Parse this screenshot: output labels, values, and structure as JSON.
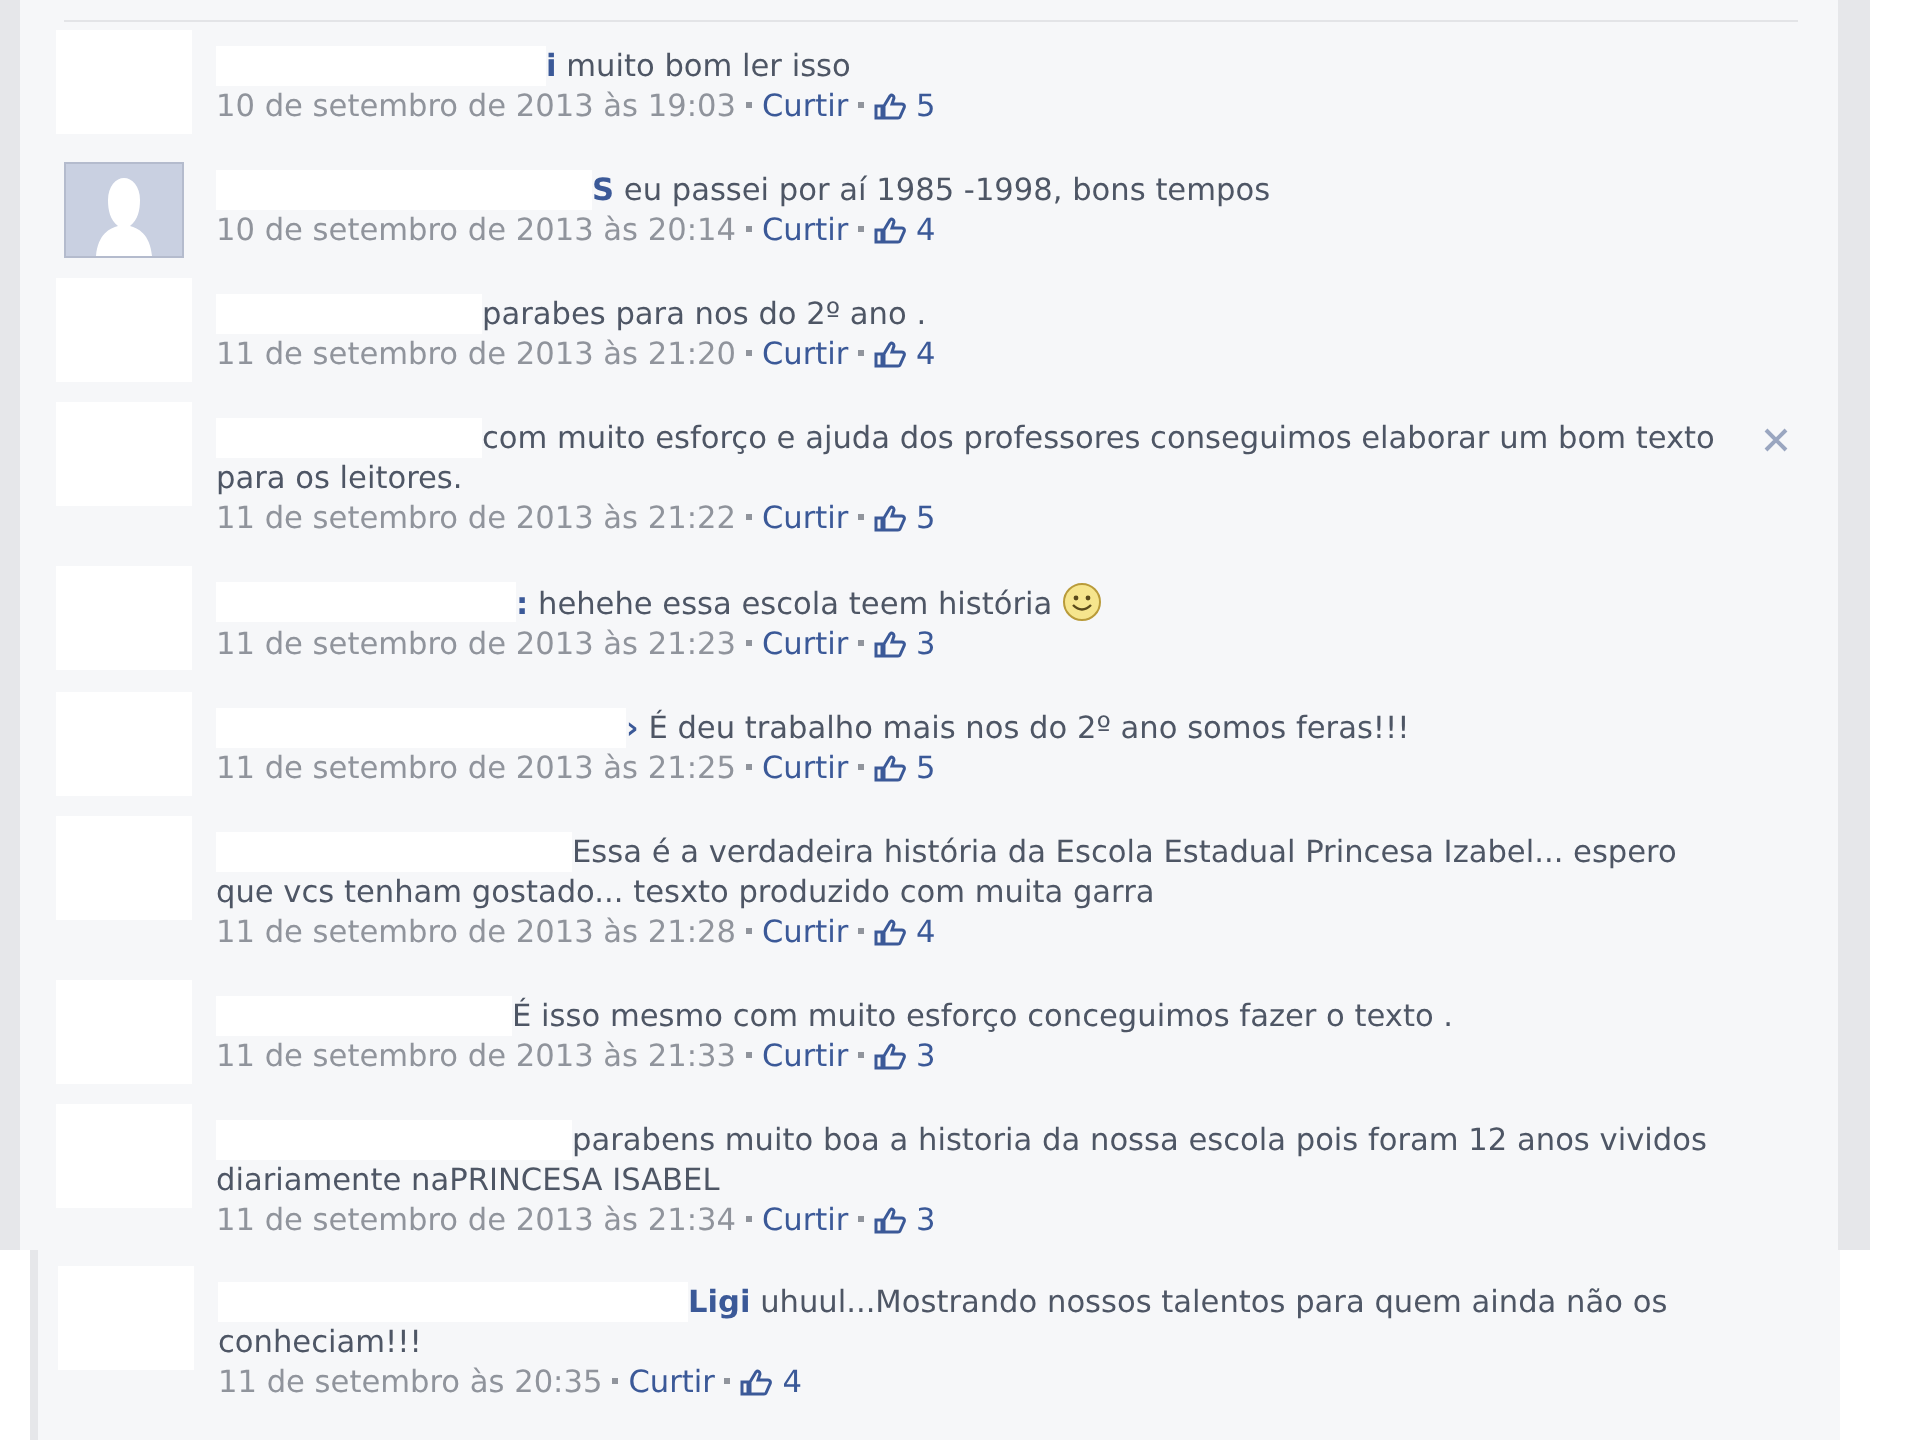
{
  "comments": [
    {
      "avatar": {
        "kind": "hidden"
      },
      "name": "i",
      "text": "muito bom ler isso",
      "time": "10 de setembro de 2013 às 19:03",
      "like_label": "Curtir",
      "likes": "5"
    },
    {
      "avatar": {
        "kind": "silhouette"
      },
      "name": "S",
      "text": "eu passei por aí 1985 -1998, bons tempos",
      "time": "10 de setembro de 2013 às 20:14",
      "like_label": "Curtir",
      "likes": "4"
    },
    {
      "avatar": {
        "kind": "hidden"
      },
      "text": "parabes para nos do 2º ano .",
      "time": "11 de setembro de 2013 às 21:20",
      "like_label": "Curtir",
      "likes": "4"
    },
    {
      "avatar": {
        "kind": "hidden"
      },
      "text": "com muito esforço e ajuda dos professores conseguimos elaborar um bom texto para os leitores.",
      "time": "11 de setembro de 2013 às 21:22",
      "like_label": "Curtir",
      "likes": "5",
      "close_button": true
    },
    {
      "avatar": {
        "kind": "hidden"
      },
      "name": ":",
      "text": "hehehe essa escola teem história",
      "emoticon": {
        "kind": "smile"
      },
      "time": "11 de setembro de 2013 às 21:23",
      "like_label": "Curtir",
      "likes": "3"
    },
    {
      "avatar": {
        "kind": "hidden"
      },
      "name": "›",
      "text": "É deu trabalho mais nos do 2º ano somos feras!!!",
      "time": "11 de setembro de 2013 às 21:25",
      "like_label": "Curtir",
      "likes": "5"
    },
    {
      "avatar": {
        "kind": "hidden"
      },
      "text": "Essa é a verdadeira história da Escola Estadual Princesa Izabel... espero que vcs tenham gostado... tesxto produzido com muita garra",
      "time": "11 de setembro de 2013 às 21:28",
      "like_label": "Curtir",
      "likes": "4"
    },
    {
      "avatar": {
        "kind": "hidden"
      },
      "text": "É isso mesmo com muito esforço conceguimos fazer o texto .",
      "time": "11 de setembro de 2013 às 21:33",
      "like_label": "Curtir",
      "likes": "3"
    },
    {
      "avatar": {
        "kind": "hidden"
      },
      "text": "parabens muito boa a historia da nossa escola pois foram  12 anos vividos diariamente naPRINCESA ISABEL",
      "time": "11 de setembro de 2013 às 21:34",
      "like_label": "Curtir",
      "likes": "3"
    }
  ],
  "later_comment": {
    "avatar": {
      "kind": "hidden"
    },
    "name": "Ligi",
    "text": "uhuul...Mostrando nossos talentos para quem ainda não os conheciam!!!",
    "time": "11 de setembro às 20:35",
    "like_label": "Curtir",
    "likes": "4"
  }
}
